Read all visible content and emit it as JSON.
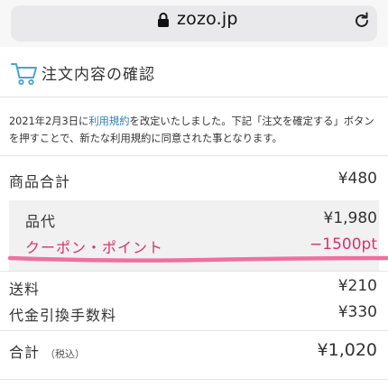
{
  "browser": {
    "url": "zozo.jp"
  },
  "header": {
    "title": "注文内容の確認"
  },
  "notice": {
    "prefix": "2021年2月3日に",
    "link": "利用規約",
    "suffix": "を改定いたしました。下記「注文を確定する」ボタンを押すことで、新たな利用規約に同意された事となります。"
  },
  "summary": {
    "subtotal_label": "商品合計",
    "subtotal_value": "¥480",
    "price_label": "品代",
    "price_value": "¥1,980",
    "coupon_label": "クーポン・ポイント",
    "coupon_value": "−1500pt",
    "shipping_label": "送料",
    "shipping_value": "¥210",
    "cod_label": "代金引換手数料",
    "cod_value": "¥330",
    "total_label": "合計",
    "total_tax_note": "（税込）",
    "total_value": "¥1,020"
  },
  "colors": {
    "accent_pink": "#f06fa0",
    "discount_text": "#d6336c",
    "link": "#2a7fb8",
    "cart_icon": "#4aa3cf"
  }
}
